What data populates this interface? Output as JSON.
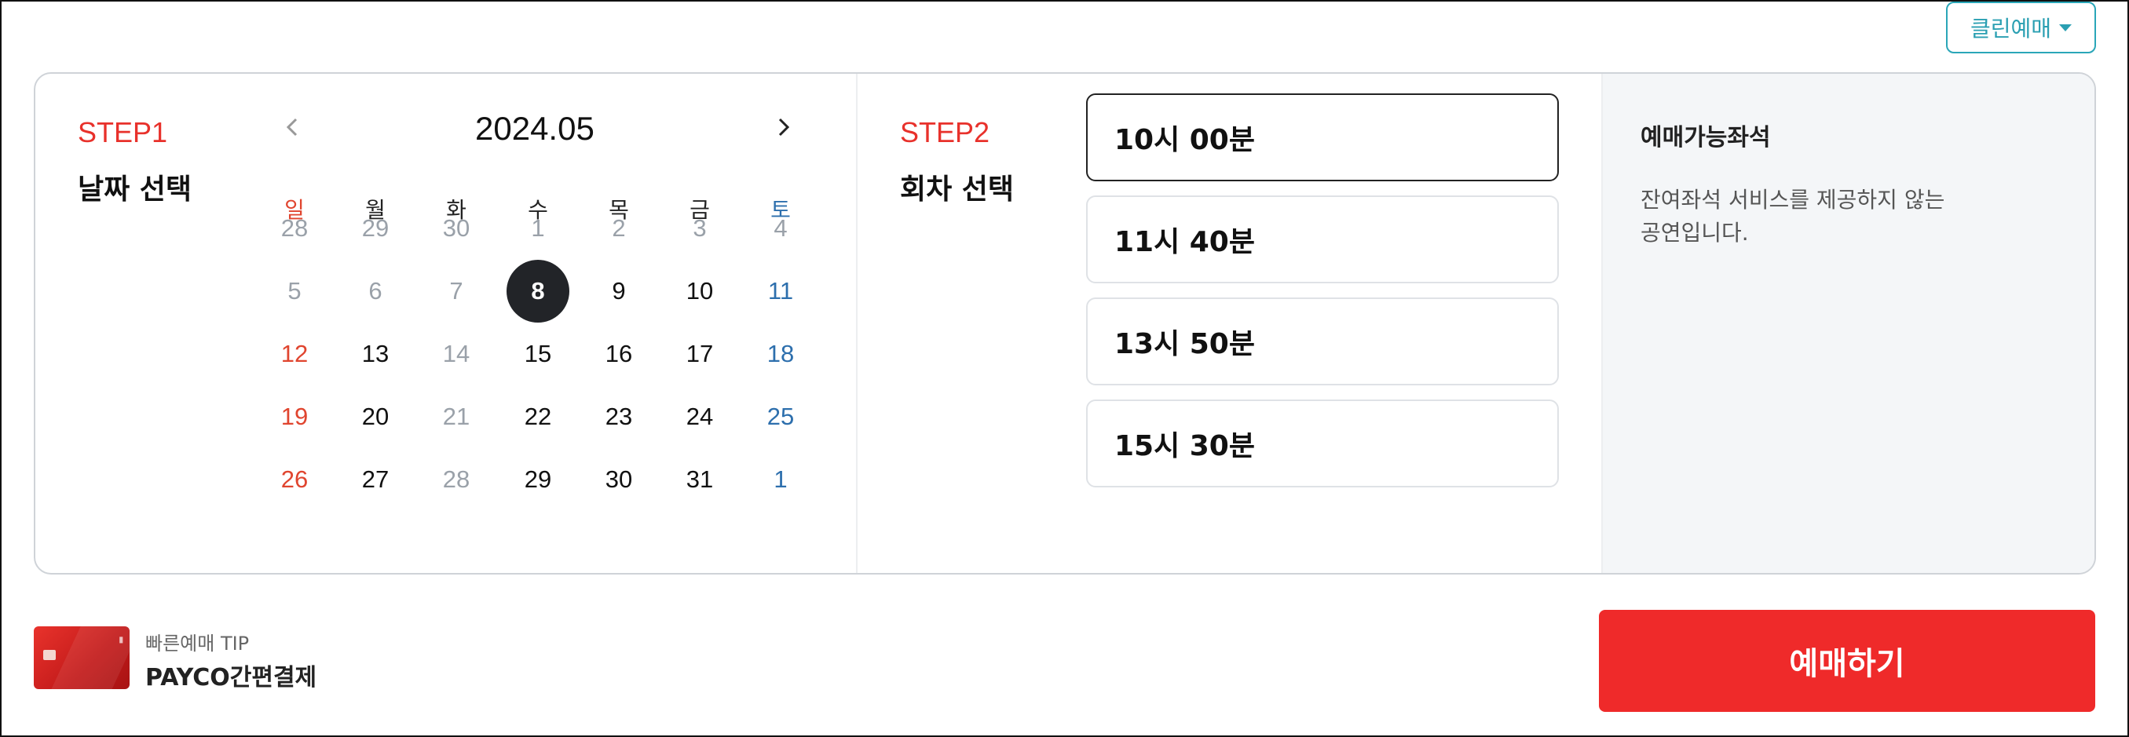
{
  "header": {
    "clean_booking_label": "클린예매"
  },
  "step1": {
    "step_label": "STEP1",
    "title": "날짜 선택",
    "month": "2024.05",
    "weekdays": [
      "일",
      "월",
      "화",
      "수",
      "목",
      "금",
      "토"
    ],
    "weeks": [
      [
        "28",
        "29",
        "30",
        "1",
        "2",
        "3",
        "4"
      ],
      [
        "5",
        "6",
        "7",
        "8",
        "9",
        "10",
        "11"
      ],
      [
        "12",
        "13",
        "14",
        "15",
        "16",
        "17",
        "18"
      ],
      [
        "19",
        "20",
        "21",
        "22",
        "23",
        "24",
        "25"
      ],
      [
        "26",
        "27",
        "28",
        "29",
        "30",
        "31",
        "1"
      ]
    ],
    "selected_date": "8"
  },
  "step2": {
    "step_label": "STEP2",
    "title": "회차 선택",
    "times": [
      "10시 00분",
      "11시 40분",
      "13시 50분",
      "15시 30분"
    ],
    "selected_index": 0
  },
  "seats": {
    "title": "예매가능좌석",
    "description": "잔여좌석 서비스를 제공하지 않는 공연입니다."
  },
  "tip": {
    "label": "빠른예매 TIP",
    "title": "PAYCO간편결제"
  },
  "book_button_label": "예매하기",
  "colors": {
    "accent_red": "#ef2a2a",
    "step_red": "#e8312b",
    "sunday": "#e0452f",
    "saturday": "#2d6fad",
    "muted": "#9aa1a9",
    "clean_teal": "#2a9fb2"
  }
}
